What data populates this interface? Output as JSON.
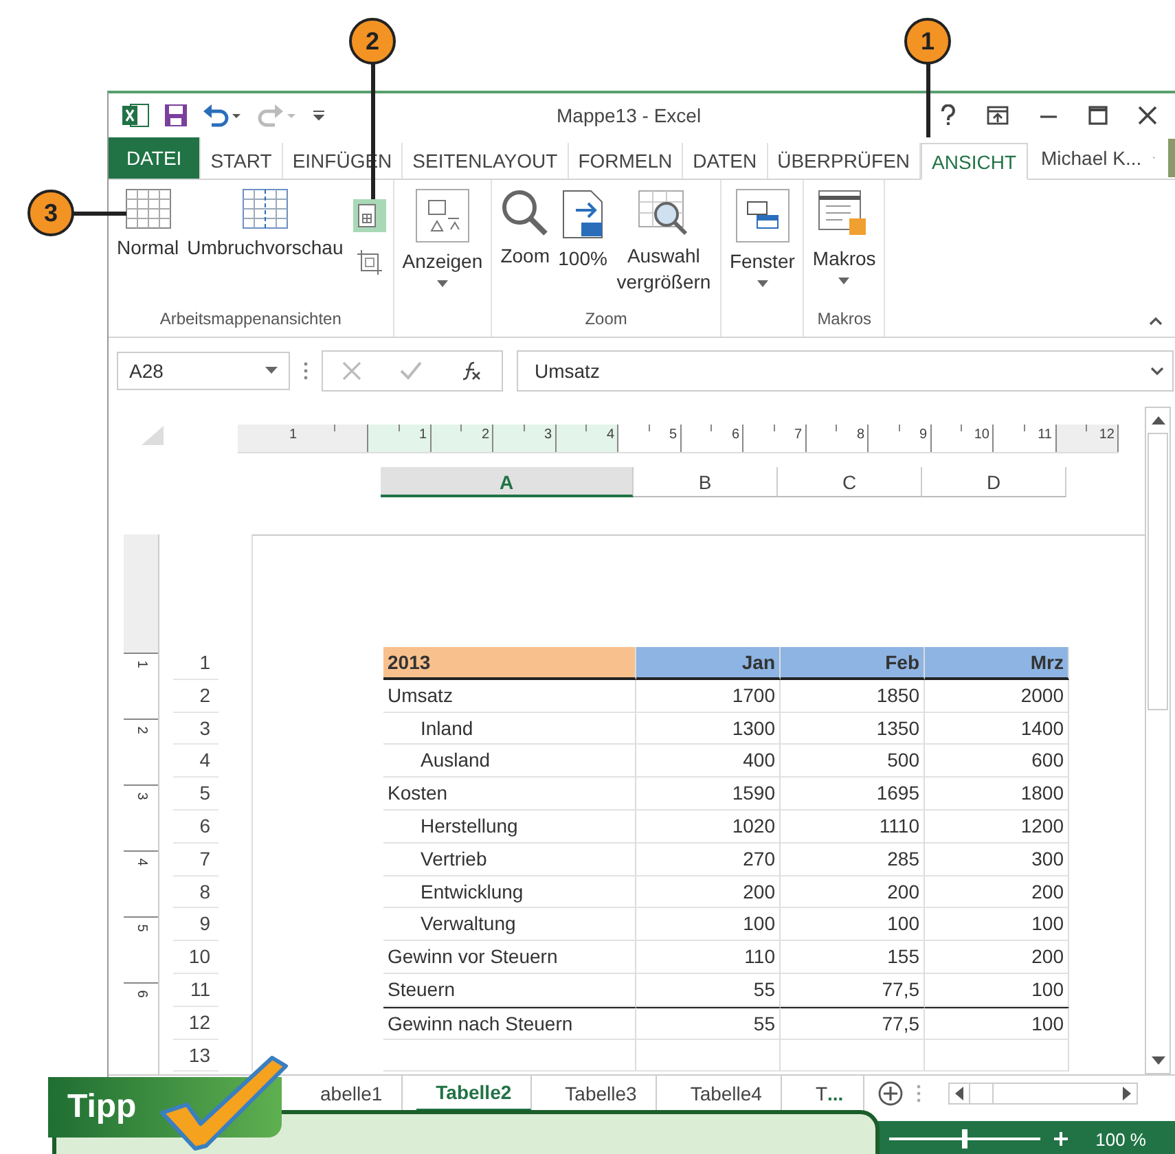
{
  "callouts": [
    {
      "number": "1"
    },
    {
      "number": "2"
    },
    {
      "number": "3"
    }
  ],
  "window": {
    "title": "Mappe13 - Excel",
    "user": "Michael K..."
  },
  "tabs": [
    {
      "label": "DATEI",
      "kind": "file",
      "selected": false
    },
    {
      "label": "START",
      "kind": "tab",
      "selected": false
    },
    {
      "label": "EINFÜGEN",
      "kind": "tab",
      "selected": false
    },
    {
      "label": "SEITENLAYOUT",
      "kind": "tab",
      "selected": false
    },
    {
      "label": "FORMELN",
      "kind": "tab",
      "selected": false
    },
    {
      "label": "DATEN",
      "kind": "tab",
      "selected": false
    },
    {
      "label": "ÜBERPRÜFEN",
      "kind": "tab",
      "selected": false
    },
    {
      "label": "ANSICHT",
      "kind": "tab",
      "selected": true
    }
  ],
  "ribbon": {
    "groups": [
      {
        "label": "Arbeitsmappenansichten",
        "buttons": [
          {
            "kind": "large",
            "label": "Normal",
            "dropdown": false,
            "selected": false
          },
          {
            "kind": "large",
            "label": "Umbruchvorschau",
            "dropdown": false,
            "selected": false
          },
          {
            "kind": "small",
            "selected": true
          },
          {
            "kind": "small",
            "selected": false
          }
        ]
      },
      {
        "buttons": [
          {
            "kind": "large",
            "label": "Anzeigen",
            "dropdown": true,
            "selected": false
          }
        ]
      },
      {
        "label": "Zoom",
        "buttons": [
          {
            "kind": "large",
            "label": "Zoom",
            "dropdown": false,
            "selected": false
          },
          {
            "kind": "large",
            "label": "100%",
            "dropdown": false,
            "selected": false
          },
          {
            "kind": "large",
            "label": "Auswahl vergrößern",
            "dropdown": false,
            "selected": false
          }
        ]
      },
      {
        "buttons": [
          {
            "kind": "large",
            "label": "Fenster",
            "dropdown": true,
            "selected": false
          }
        ]
      },
      {
        "label": "Makros",
        "buttons": [
          {
            "kind": "large",
            "label": "Makros",
            "dropdown": true,
            "selected": false
          }
        ]
      }
    ]
  },
  "formula_bar": {
    "name_box": "A28",
    "value": "Umsatz"
  },
  "ruler": {
    "ticks": [
      "1",
      "1",
      "2",
      "3",
      "4",
      "5",
      "6",
      "7",
      "8",
      "9",
      "10",
      "11",
      "12"
    ]
  },
  "vertical_ruler": {
    "ticks": [
      "1",
      "2",
      "3",
      "4",
      "5",
      "6"
    ]
  },
  "columns": [
    {
      "label": "A",
      "selected": true
    },
    {
      "label": "B",
      "selected": false
    },
    {
      "label": "C",
      "selected": false
    },
    {
      "label": "D",
      "selected": false
    }
  ],
  "rows": [
    {
      "number": "1",
      "kind": "header",
      "indented": false,
      "cells": [
        "2013",
        "Jan",
        "Feb",
        "Mrz"
      ]
    },
    {
      "number": "2",
      "kind": "data",
      "indented": false,
      "cells": [
        "Umsatz",
        "1700",
        "1850",
        "2000"
      ]
    },
    {
      "number": "3",
      "kind": "data",
      "indented": true,
      "cells": [
        "Inland",
        "1300",
        "1350",
        "1400"
      ]
    },
    {
      "number": "4",
      "kind": "data",
      "indented": true,
      "cells": [
        "Ausland",
        "400",
        "500",
        "600"
      ]
    },
    {
      "number": "5",
      "kind": "data",
      "indented": false,
      "cells": [
        "Kosten",
        "1590",
        "1695",
        "1800"
      ]
    },
    {
      "number": "6",
      "kind": "data",
      "indented": true,
      "cells": [
        "Herstellung",
        "1020",
        "1110",
        "1200"
      ]
    },
    {
      "number": "7",
      "kind": "data",
      "indented": true,
      "cells": [
        "Vertrieb",
        "270",
        "285",
        "300"
      ]
    },
    {
      "number": "8",
      "kind": "data",
      "indented": true,
      "cells": [
        "Entwicklung",
        "200",
        "200",
        "200"
      ]
    },
    {
      "number": "9",
      "kind": "data",
      "indented": true,
      "cells": [
        "Verwaltung",
        "100",
        "100",
        "100"
      ]
    },
    {
      "number": "10",
      "kind": "data",
      "indented": false,
      "cells": [
        "Gewinn vor Steuern",
        "110",
        "155",
        "200"
      ]
    },
    {
      "number": "11",
      "kind": "data",
      "indented": false,
      "cells": [
        "Steuern",
        "55",
        "77,5",
        "100"
      ]
    },
    {
      "number": "12",
      "kind": "total",
      "indented": false,
      "cells": [
        "Gewinn nach Steuern",
        "55",
        "77,5",
        "100"
      ]
    },
    {
      "number": "13",
      "kind": "data",
      "cells": []
    }
  ],
  "sheet_tabs": [
    {
      "label": "abelle1",
      "selected": false
    },
    {
      "label": "Tabelle2",
      "selected": true
    },
    {
      "label": "Tabelle3",
      "selected": false
    },
    {
      "label": "Tabelle4",
      "selected": false
    },
    {
      "label": "T",
      "more": "...",
      "selected": false
    }
  ],
  "status_bar": {
    "level": 0.5,
    "zoom": "100 %"
  },
  "tip": {
    "title": "Tipp"
  }
}
